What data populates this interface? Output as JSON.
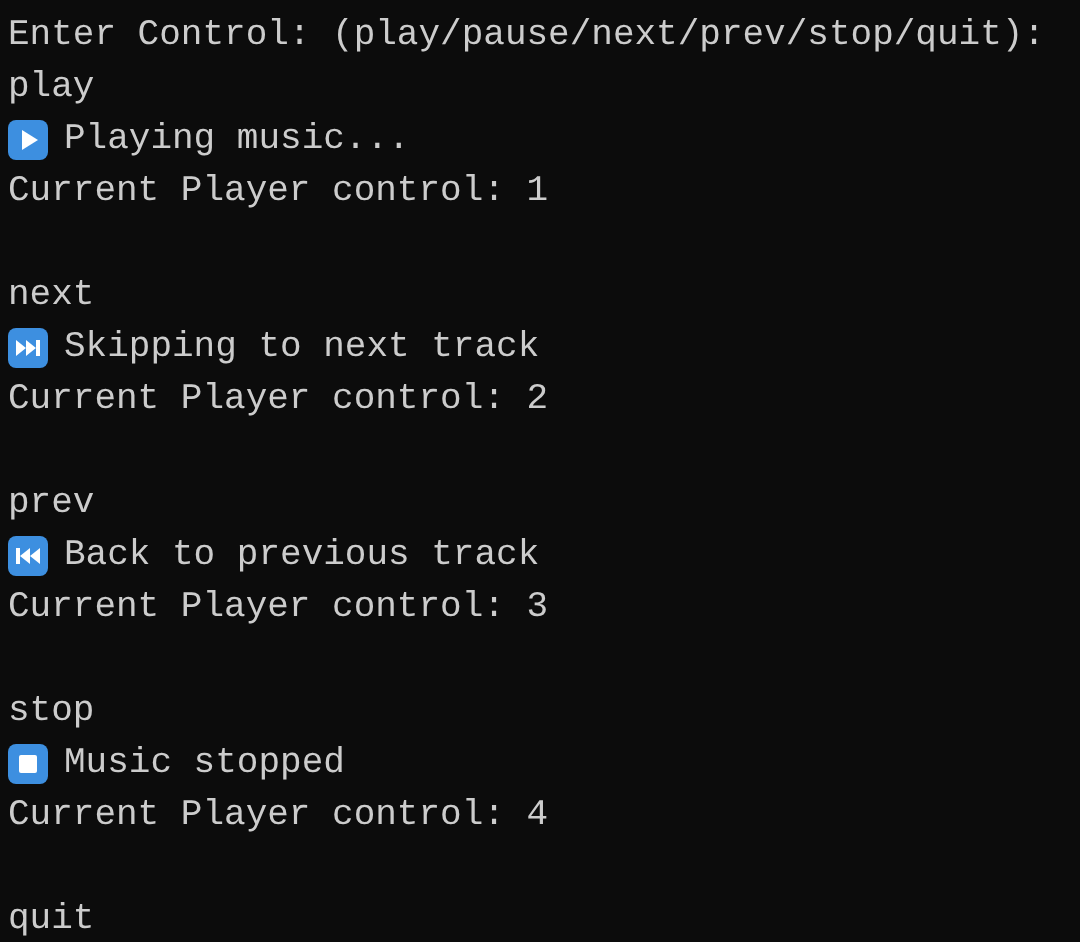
{
  "terminal": {
    "prompt": "Enter Control: (play/pause/next/prev/stop/quit):",
    "blocks": [
      {
        "lines": [
          {
            "kind": "text",
            "text": "play"
          },
          {
            "kind": "play",
            "text": "Playing music..."
          },
          {
            "kind": "text",
            "text": "Current Player control: 1"
          }
        ]
      },
      {
        "lines": [
          {
            "kind": "text",
            "text": "next"
          },
          {
            "kind": "next",
            "text": "Skipping to next track"
          },
          {
            "kind": "text",
            "text": "Current Player control: 2"
          }
        ]
      },
      {
        "lines": [
          {
            "kind": "text",
            "text": "prev"
          },
          {
            "kind": "prev",
            "text": "Back to previous track"
          },
          {
            "kind": "text",
            "text": "Current Player control: 3"
          }
        ]
      },
      {
        "lines": [
          {
            "kind": "text",
            "text": "stop"
          },
          {
            "kind": "stop",
            "text": "Music stopped"
          },
          {
            "kind": "text",
            "text": "Current Player control: 4"
          }
        ]
      },
      {
        "lines": [
          {
            "kind": "text",
            "text": "quit"
          }
        ]
      }
    ]
  }
}
